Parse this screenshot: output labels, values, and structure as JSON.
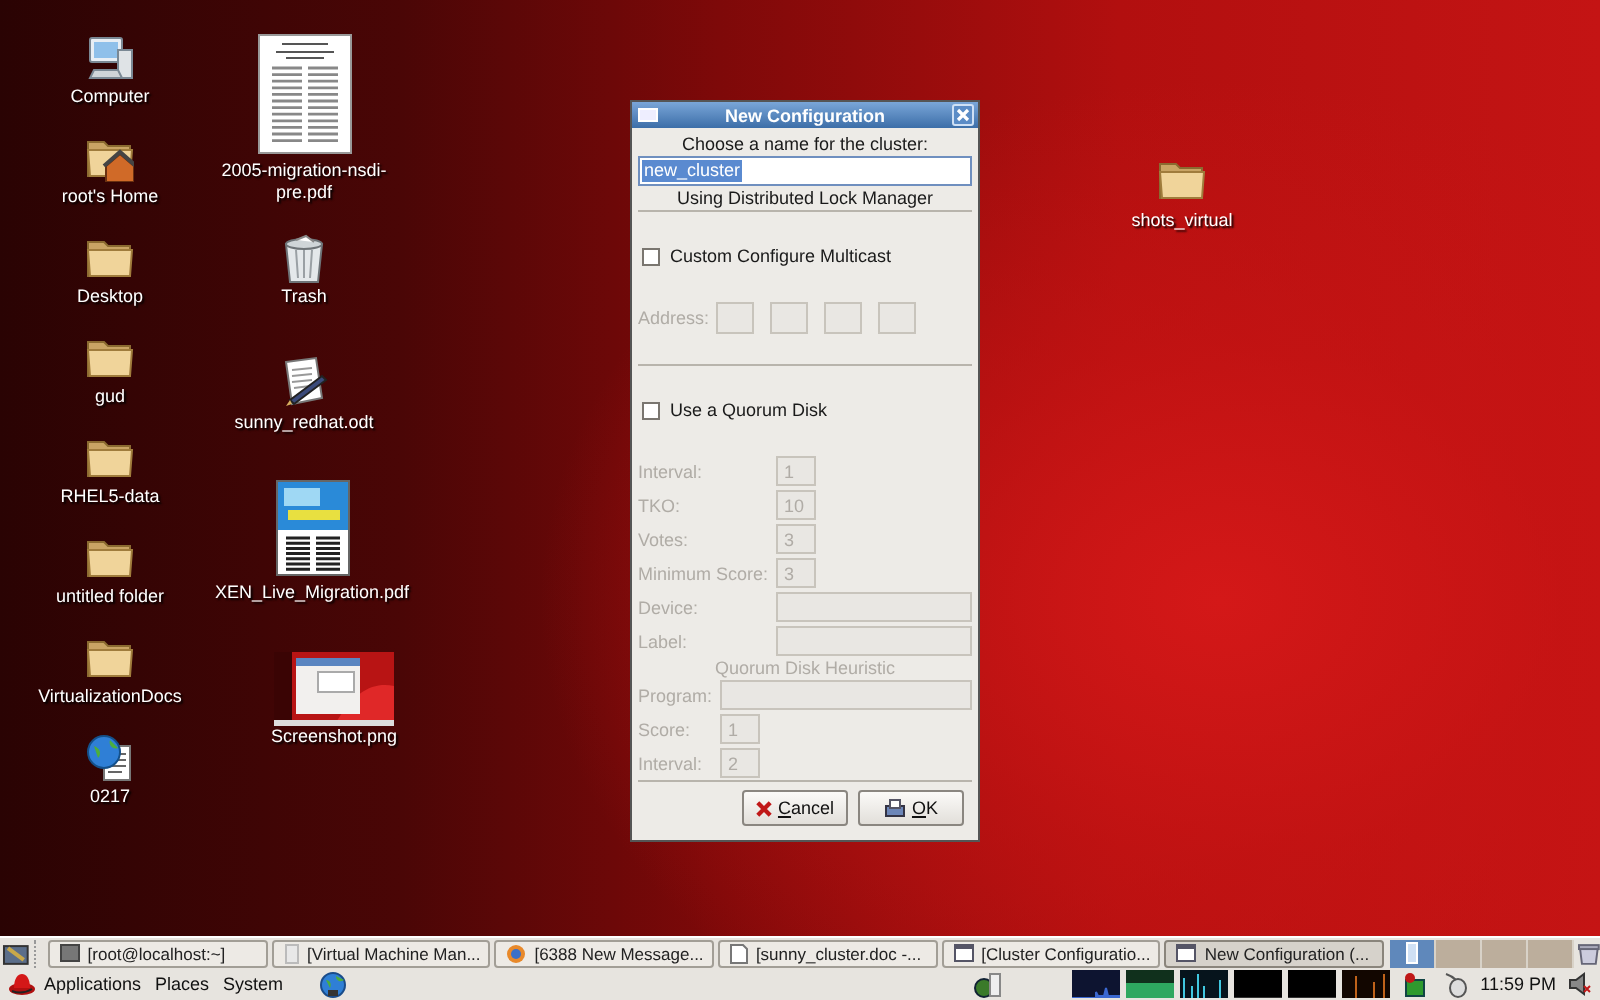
{
  "desktop_icons": [
    {
      "label": "Computer",
      "kind": "computer"
    },
    {
      "label": "root's Home",
      "kind": "home"
    },
    {
      "label": "Desktop",
      "kind": "folder"
    },
    {
      "label": "gud",
      "kind": "folder"
    },
    {
      "label": "RHEL5-data",
      "kind": "folder"
    },
    {
      "label": "untitled folder",
      "kind": "folder"
    },
    {
      "label": "VirtualizationDocs",
      "kind": "folder"
    },
    {
      "label": "0217",
      "kind": "web-doc"
    },
    {
      "label": "2005-migration-nsdi-pre.pdf",
      "kind": "pdf"
    },
    {
      "label": "Trash",
      "kind": "trash"
    },
    {
      "label": "sunny_redhat.odt",
      "kind": "text-doc"
    },
    {
      "label": "XEN_Live_Migration.pdf",
      "kind": "poster"
    },
    {
      "label": "Screenshot.png",
      "kind": "picture"
    },
    {
      "label": "shots_virtual",
      "kind": "folder"
    }
  ],
  "dialog": {
    "title": "New Configuration",
    "name_prompt": "Choose a name for the cluster:",
    "name_value": "new_cluster",
    "name_selected": true,
    "lock_manager": "Using Distributed Lock Manager",
    "multicast": {
      "label": "Custom Configure Multicast",
      "checked": false
    },
    "address": {
      "label": "Address:",
      "disabled": true
    },
    "quorum": {
      "label": "Use a Quorum Disk",
      "checked": false
    },
    "quorum_fields": [
      {
        "label": "Interval:",
        "value": "1",
        "kind": "short",
        "disabled": true
      },
      {
        "label": "TKO:",
        "value": "10",
        "kind": "short",
        "disabled": true
      },
      {
        "label": "Votes:",
        "value": "3",
        "kind": "short",
        "disabled": true
      },
      {
        "label": "Minimum Score:",
        "value": "3",
        "kind": "short",
        "disabled": true
      },
      {
        "label": "Device:",
        "kind": "wide",
        "disabled": true
      },
      {
        "label": "Label:",
        "kind": "wide",
        "disabled": true
      }
    ],
    "heuristic_title": "Quorum Disk Heuristic",
    "heuristic_fields": [
      {
        "label": "Program:",
        "kind": "wide",
        "disabled": true
      },
      {
        "label": "Score:",
        "value": "1",
        "kind": "short",
        "disabled": true
      },
      {
        "label": "Interval:",
        "value": "2",
        "kind": "short",
        "disabled": true
      }
    ],
    "buttons": [
      {
        "label": "Cancel",
        "kind": "cancel"
      },
      {
        "label": "OK",
        "kind": "ok"
      }
    ]
  },
  "window_list": [
    {
      "label": "[root@localhost:~]",
      "kind": "terminal",
      "selected": false
    },
    {
      "label": "[Virtual Machine Man...",
      "kind": "app",
      "selected": false
    },
    {
      "label": "[6388 New Message...",
      "kind": "browser",
      "selected": false
    },
    {
      "label": "[sunny_cluster.doc -...",
      "kind": "doc",
      "selected": false
    },
    {
      "label": "[Cluster Configuratio...",
      "kind": "window",
      "selected": false
    },
    {
      "label": "New Configuration (...",
      "kind": "window",
      "selected": true
    }
  ],
  "workspaces": [
    {
      "selected": true
    },
    {
      "selected": false
    },
    {
      "selected": false
    },
    {
      "selected": false
    }
  ],
  "menu_bar": [
    "Applications",
    "Places",
    "System"
  ],
  "clock": "11:59 PM"
}
